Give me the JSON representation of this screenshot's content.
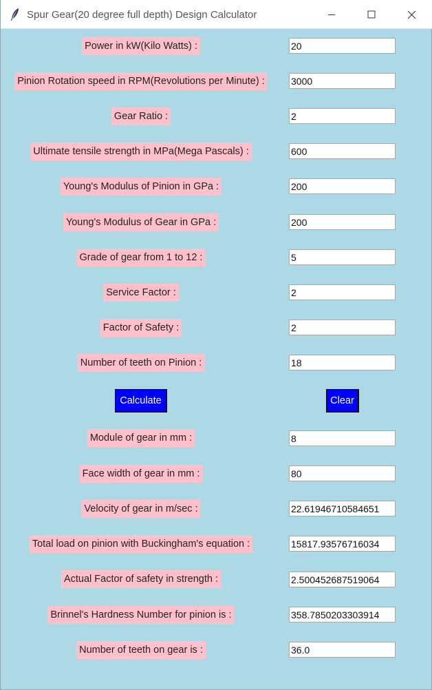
{
  "window": {
    "title": "Spur Gear(20 degree full depth) Design Calculator",
    "icon": "feather-icon",
    "controls": [
      "minimize-icon",
      "maximize-icon",
      "close-icon"
    ]
  },
  "colors": {
    "background": "#add8e6",
    "label_bg": "#ffc0cb",
    "button_bg": "#0000ff",
    "button_text": "#ffffff"
  },
  "inputs": [
    {
      "label": "Power in kW(Kilo Watts) :",
      "value": "20"
    },
    {
      "label": "Pinion Rotation speed in RPM(Revolutions per Minute) :",
      "value": "3000"
    },
    {
      "label": "Gear Ratio :",
      "value": "2"
    },
    {
      "label": "Ultimate tensile strength in MPa(Mega Pascals) :",
      "value": "600"
    },
    {
      "label": "Young's Modulus of Pinion in GPa  :",
      "value": "200"
    },
    {
      "label": "Young's Modulus of Gear in GPa  :",
      "value": "200"
    },
    {
      "label": "Grade of gear from 1 to 12  :",
      "value": "5"
    },
    {
      "label": "Service Factor  :",
      "value": "2"
    },
    {
      "label": "Factor of Safety  :",
      "value": "2"
    },
    {
      "label": "Number of teeth on Pinion  :",
      "value": "18"
    }
  ],
  "buttons": {
    "calculate": "Calculate",
    "clear": "Clear"
  },
  "outputs": [
    {
      "label": "Module of gear in mm  :",
      "value": "8"
    },
    {
      "label": "Face width of gear in mm  :",
      "value": "80"
    },
    {
      "label": "Velocity of gear in m/sec  :",
      "value": "22.61946710584651"
    },
    {
      "label": "Total load on pinion with Buckingham's equation  :",
      "value": "15817.93576716034"
    },
    {
      "label": "Actual Factor of safety in strength  :",
      "value": "2.500452687519064"
    },
    {
      "label": "Brinnel's Hardness Number for pinion is  :",
      "value": "358.7850203303914"
    },
    {
      "label": "Number of teeth on gear is  :",
      "value": "36.0"
    }
  ]
}
